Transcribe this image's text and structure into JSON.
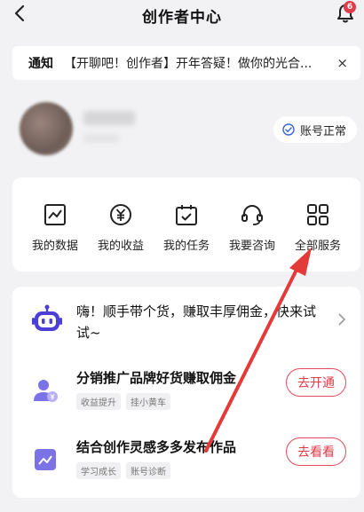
{
  "header": {
    "title": "创作者中心",
    "bell_badge": "6"
  },
  "notice": {
    "tag": "通知",
    "text": "【开聊吧！创作者】开年答疑！做你的光合...",
    "close": "×"
  },
  "profile": {
    "status": "账号正常"
  },
  "services": [
    {
      "label": "我的数据",
      "icon": "chart-icon"
    },
    {
      "label": "我的收益",
      "icon": "yen-icon"
    },
    {
      "label": "我的任务",
      "icon": "calendar-check-icon"
    },
    {
      "label": "我要咨询",
      "icon": "headset-icon"
    },
    {
      "label": "全部服务",
      "icon": "grid-icon"
    }
  ],
  "promo": {
    "headline": "嗨！顺手带个货，赚取丰厚佣金，快来试试~",
    "tasks": [
      {
        "title": "分销推广品牌好货赚取佣金",
        "tags": [
          "收益提升",
          "挂小黄车"
        ],
        "button": "去开通"
      },
      {
        "title": "结合创作灵感多多发布作品",
        "tags": [
          "学习成长",
          "账号诊断"
        ],
        "button": "去看看"
      }
    ]
  },
  "colors": {
    "accent": "#e23b4a",
    "brand": "#4b3fd6",
    "background": "#f2f2f4"
  }
}
